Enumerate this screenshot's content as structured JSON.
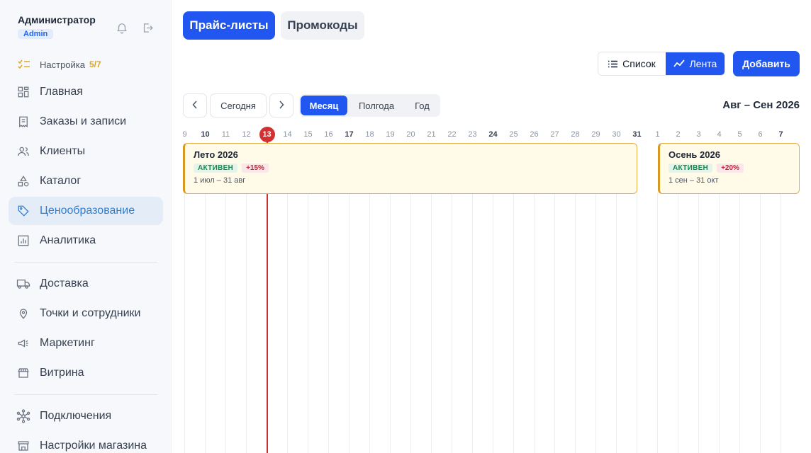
{
  "user": {
    "name": "Администратор",
    "role": "Admin"
  },
  "setup": {
    "label": "Настройка",
    "progress": "5/7"
  },
  "nav": {
    "items": [
      {
        "id": "home",
        "label": "Главная",
        "icon": "grid-icon"
      },
      {
        "id": "orders",
        "label": "Заказы и записи",
        "icon": "receipt-icon"
      },
      {
        "id": "clients",
        "label": "Клиенты",
        "icon": "users-icon"
      },
      {
        "id": "catalog",
        "label": "Каталог",
        "icon": "shapes-icon"
      },
      {
        "id": "pricing",
        "label": "Ценообразование",
        "icon": "tag-icon",
        "active": true
      },
      {
        "id": "analytics",
        "label": "Аналитика",
        "icon": "chart-icon"
      },
      {
        "id": "delivery",
        "label": "Доставка",
        "icon": "truck-icon"
      },
      {
        "id": "locations",
        "label": "Точки и сотрудники",
        "icon": "pin-icon"
      },
      {
        "id": "marketing",
        "label": "Маркетинг",
        "icon": "megaphone-icon"
      },
      {
        "id": "storefront",
        "label": "Витрина",
        "icon": "store-icon"
      },
      {
        "id": "integrations",
        "label": "Подключения",
        "icon": "network-icon"
      },
      {
        "id": "store-settings",
        "label": "Настройки магазина",
        "icon": "shop-settings-icon"
      }
    ]
  },
  "tabs": {
    "price_lists": "Прайс-листы",
    "promo": "Промокоды"
  },
  "view_toggle": {
    "list": "Список",
    "feed": "Лента",
    "selected": "feed"
  },
  "actions": {
    "add": "Добавить"
  },
  "controls": {
    "today": "Сегодня",
    "periods": [
      "Месяц",
      "Полгода",
      "Год"
    ],
    "selected_period": "Месяц"
  },
  "range_title": "Авг – Сен 2026",
  "timeline": {
    "days": [
      "9",
      "10",
      "11",
      "12",
      "13",
      "14",
      "15",
      "16",
      "17",
      "18",
      "19",
      "20",
      "21",
      "22",
      "23",
      "24",
      "25",
      "26",
      "27",
      "28",
      "29",
      "30",
      "31",
      "1",
      "2",
      "3",
      "4",
      "5",
      "6",
      "7"
    ],
    "bold_days": [
      "10",
      "17",
      "24",
      "31",
      "7"
    ],
    "today_index": 4
  },
  "price_lists": [
    {
      "name": "Лето 2026",
      "status": "АКТИВЕН",
      "markup": "+15%",
      "dates": "1 июл – 31 авг"
    },
    {
      "name": "Осень 2026",
      "status": "АКТИВЕН",
      "markup": "+20%",
      "dates": "1 сен – 31 окт"
    }
  ]
}
